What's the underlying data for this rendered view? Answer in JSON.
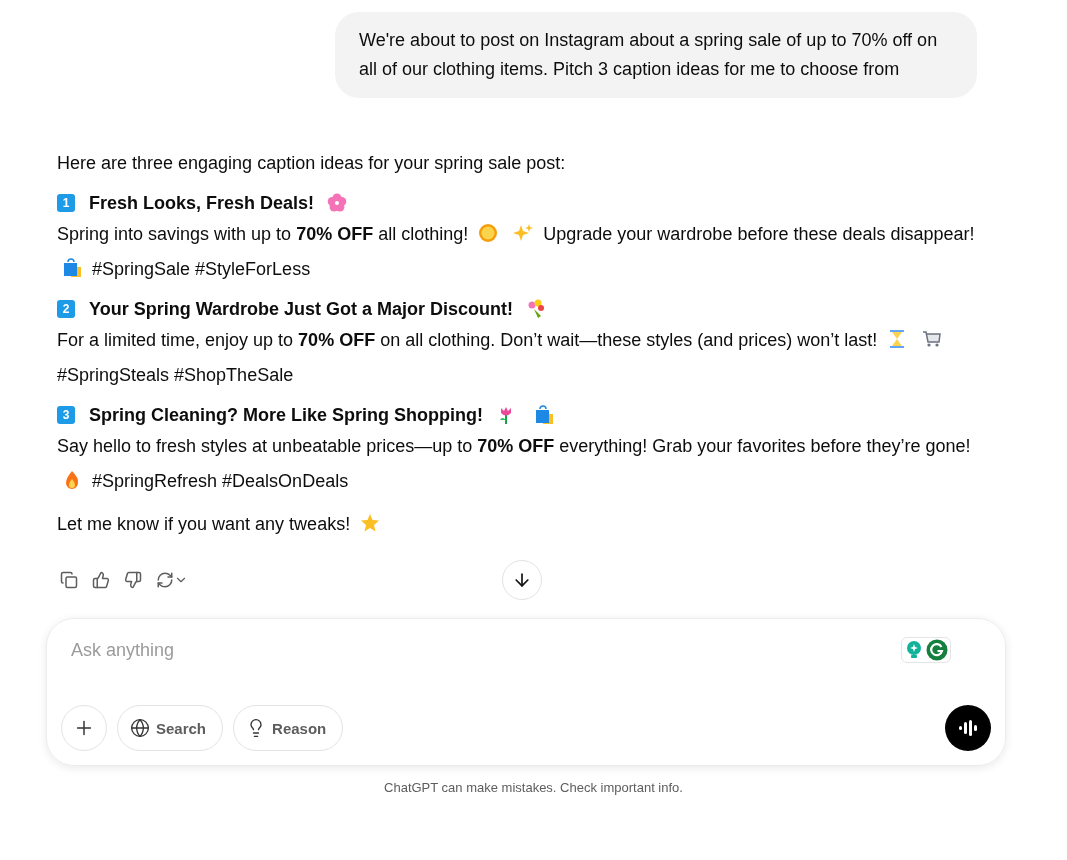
{
  "user_message": "We're about to post on Instagram about a spring sale of up to 70% off on all of our clothing items. Pitch 3 caption ideas for me to choose from",
  "reply": {
    "intro": "Here are three engaging caption ideas for your spring sale post:",
    "captions": [
      {
        "number": "1",
        "title": [
          {
            "kind": "text",
            "text": "Fresh Looks, Fresh Deals!"
          },
          {
            "kind": "blossom"
          }
        ],
        "body": [
          {
            "kind": "text",
            "text": "Spring into savings with up to **70% OFF** all clothing!"
          },
          {
            "kind": "sun"
          },
          {
            "kind": "sparkles"
          },
          {
            "kind": "text",
            "text": "Upgrade your wardrobe before these deals"
          },
          {
            "kind": "text",
            "text": "disappear!"
          },
          {
            "kind": "bag"
          },
          {
            "kind": "text",
            "text": "#SpringSale #StyleForLess"
          }
        ]
      },
      {
        "number": "2",
        "title": [
          {
            "kind": "text",
            "text": "Your Spring Wardrobe Just Got a Major Discount!"
          },
          {
            "kind": "bouquet"
          }
        ],
        "body": [
          {
            "kind": "text",
            "text": "For a limited time, enjoy up to **70% OFF** on all clothing. Don’t wait—these styles (and prices) won’t last!"
          },
          {
            "kind": "hourglass"
          },
          {
            "kind": "cart"
          },
          {
            "kind": "text",
            "text": "#SpringSteals #ShopTheSale"
          }
        ]
      },
      {
        "number": "3",
        "title": [
          {
            "kind": "text",
            "text": "Spring Cleaning? More Like Spring Shopping!"
          },
          {
            "kind": "tulip"
          },
          {
            "kind": "bag"
          }
        ],
        "body": [
          {
            "kind": "text",
            "text": "Say hello to fresh styles at unbeatable prices—up to **70% OFF** everything! Grab your favorites before"
          },
          {
            "kind": "text",
            "text": "they’re gone!"
          },
          {
            "kind": "fire"
          },
          {
            "kind": "text",
            "text": "#SpringRefresh #DealsOnDeals"
          }
        ]
      }
    ],
    "outro": [
      {
        "kind": "text",
        "text": "Let me know if you want any tweaks!"
      },
      {
        "kind": "star"
      }
    ]
  },
  "composer": {
    "placeholder": "Ask anything",
    "buttons": [
      {
        "kind": "add"
      },
      {
        "kind": "globe",
        "label": "Search"
      },
      {
        "kind": "bulb",
        "label": "Reason"
      }
    ]
  },
  "footer": "ChatGPT can make mistakes. Check important info."
}
